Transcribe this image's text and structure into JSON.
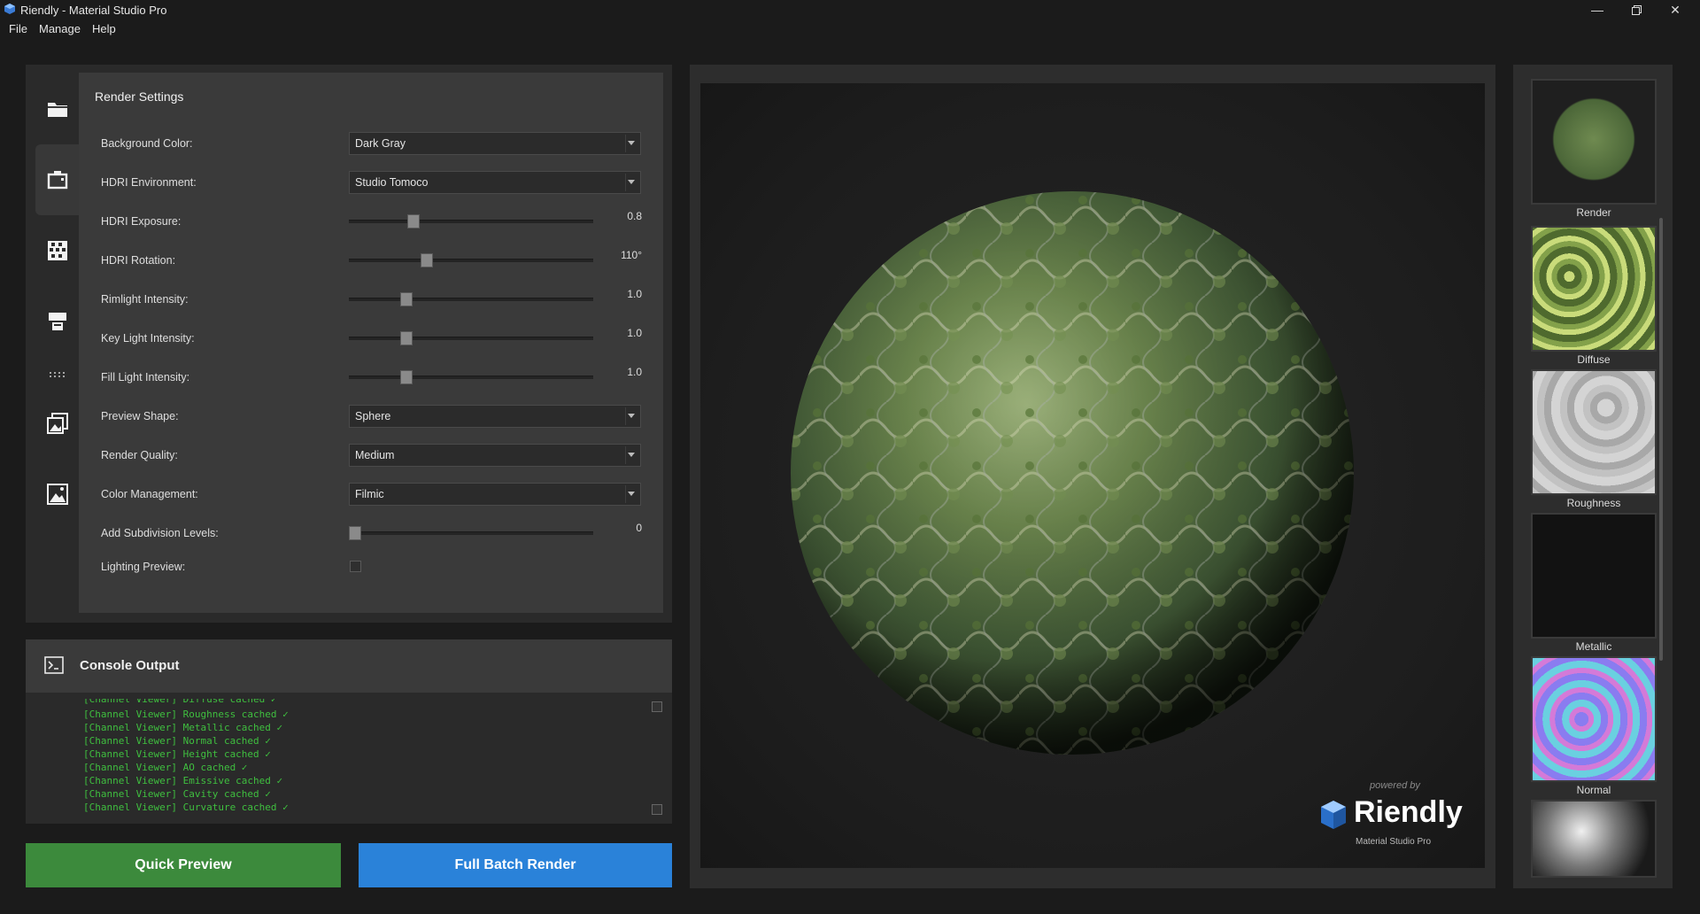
{
  "window": {
    "title": "Riendly - Material Studio Pro",
    "controls": [
      "minimize-icon",
      "maximize-icon",
      "close-icon"
    ]
  },
  "menu": {
    "file": "File",
    "manage": "Manage",
    "help": "Help"
  },
  "settings": {
    "title": "Render Settings",
    "background_color": {
      "label": "Background Color:",
      "value": "Dark Gray"
    },
    "hdri_environment": {
      "label": "HDRI Environment:",
      "value": "Studio Tomoco"
    },
    "hdri_exposure": {
      "label": "HDRI Exposure:",
      "value": "0.8",
      "level": 0.25
    },
    "hdri_rotation": {
      "label": "HDRI Rotation:",
      "value": "110°",
      "level": 0.31
    },
    "rimlight_intensity": {
      "label": "Rimlight Intensity:",
      "value": "1.0",
      "level": 0.22
    },
    "key_light_intensity": {
      "label": "Key Light Intensity:",
      "value": "1.0",
      "level": 0.22
    },
    "fill_light_intensity": {
      "label": "Fill Light Intensity:",
      "value": "1.0",
      "level": 0.22
    },
    "preview_shape": {
      "label": "Preview Shape:",
      "value": "Sphere"
    },
    "render_quality": {
      "label": "Render Quality:",
      "value": "Medium"
    },
    "color_management": {
      "label": "Color Management:",
      "value": "Filmic"
    },
    "subdivision_levels": {
      "label": "Add Subdivision Levels:",
      "value": "0",
      "level": 0.0
    },
    "lighting_preview": {
      "label": "Lighting Preview:",
      "checked": false
    }
  },
  "rail_icons": [
    "folder-icon",
    "camera-icon",
    "checker-icon",
    "printer-icon",
    "dots-icon",
    "gallery-icon",
    "image-icon"
  ],
  "console": {
    "title": "Console Output",
    "lines": [
      "[Channel Viewer] Diffuse cached ✓",
      "[Channel Viewer] Roughness cached ✓",
      "[Channel Viewer] Metallic cached ✓",
      "[Channel Viewer] Normal cached ✓",
      "[Channel Viewer] Height cached ✓",
      "[Channel Viewer] AO cached ✓",
      "[Channel Viewer] Emissive cached ✓",
      "[Channel Viewer] Cavity cached ✓",
      "[Channel Viewer] Curvature cached ✓"
    ]
  },
  "actions": {
    "quick_preview": "Quick Preview",
    "full_batch_render": "Full Batch Render"
  },
  "viewport": {
    "powered_by": "powered by",
    "brand": "Riendly",
    "product": "Material Studio Pro"
  },
  "channels": [
    {
      "label": "Render"
    },
    {
      "label": "Diffuse"
    },
    {
      "label": "Roughness"
    },
    {
      "label": "Metallic"
    },
    {
      "label": "Normal"
    },
    {
      "label": ""
    }
  ],
  "colors": {
    "accent_green": "#3c8a3c",
    "accent_blue": "#2a82d9",
    "console_text": "#3fbf3f"
  }
}
